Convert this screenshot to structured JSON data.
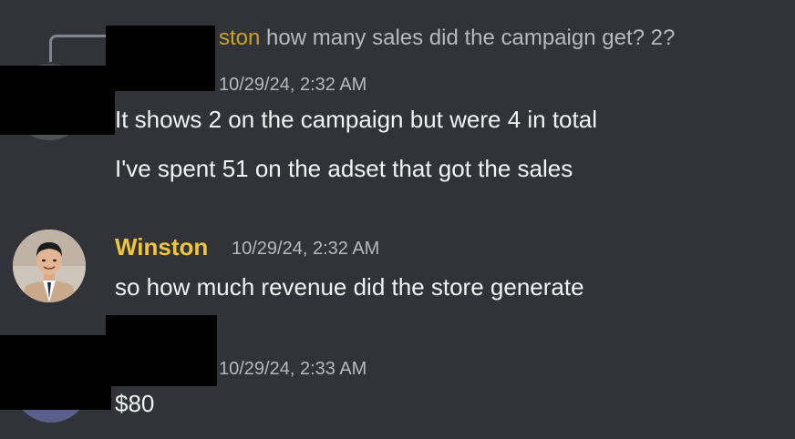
{
  "messages": [
    {
      "reply_to": {
        "author_partial": "ston",
        "text": "how many sales did the campaign get? 2?"
      },
      "timestamp": "10/29/24, 2:32 AM",
      "lines": [
        "It shows 2 on the campaign but were 4 in total",
        "I've spent 51 on the adset that got the sales"
      ]
    },
    {
      "author": "Winston",
      "author_color": "#f0c53e",
      "timestamp": "10/29/24, 2:32 AM",
      "lines": [
        "so how much revenue did the store generate"
      ]
    },
    {
      "timestamp": "10/29/24, 2:33 AM",
      "lines": [
        "$80"
      ]
    }
  ],
  "icons": {
    "winston_avatar": "person-in-suit-avatar",
    "reply_spine": "reply-connector"
  },
  "colors": {
    "background": "#313338",
    "redaction": "#000000",
    "reply_author": "#c9a227"
  }
}
